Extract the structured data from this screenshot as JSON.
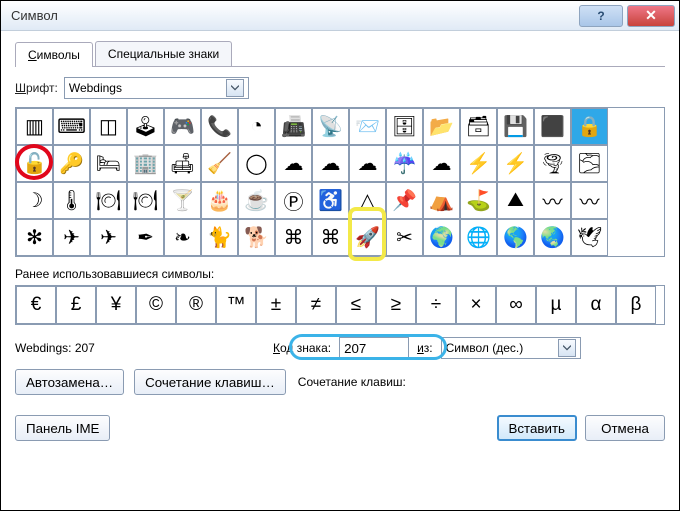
{
  "title": "Символ",
  "tabs": {
    "symbols": "Символы",
    "special": "Специальные знаки"
  },
  "font_label": "Шрифт:",
  "font_value": "Webdings",
  "grid": [
    [
      "▥",
      "⌨",
      "◫",
      "🕹",
      "🎮",
      "📞",
      "◔",
      "📠",
      "📡",
      "📨",
      "🗄",
      "📂",
      "🗃",
      "💾",
      "⬛",
      "🔒"
    ],
    [
      "🔓",
      "🔑",
      "🛏",
      "🏢",
      "🛋",
      "🧹",
      "◯",
      "☁",
      "☁",
      "☁",
      "☔",
      "☁",
      "⚡",
      "⚡",
      "🌪",
      "🌫"
    ],
    [
      "☽",
      "🌡",
      "🍽",
      "🍽",
      "🍸",
      "🎂",
      "☕",
      "Ⓟ",
      "♿",
      "△",
      "📌",
      "⛺",
      "⛳",
      "⛰",
      "〰",
      "〰"
    ],
    [
      "✻",
      "✈",
      "✈",
      "✒",
      "❧",
      "🐈",
      "🐕",
      "⌘",
      "⌘",
      "🚀",
      "✂",
      "🌍",
      "🌐",
      "🌎",
      "🌏",
      "🕊"
    ]
  ],
  "selected": {
    "row": 0,
    "col": 15
  },
  "recent_label": "Ранее использовавшиеся символы:",
  "recent": [
    "€",
    "£",
    "¥",
    "©",
    "®",
    "™",
    "±",
    "≠",
    "≤",
    "≥",
    "÷",
    "×",
    "∞",
    "µ",
    "α",
    "β"
  ],
  "info_name": "Webdings: 207",
  "code_label": "Код знака:",
  "code_value": "207",
  "from_label": "из:",
  "from_value": "Символ (дес.)",
  "autocorrect": "Автозамена…",
  "shortcut_btn": "Сочетание клавиш…",
  "shortcut_label": "Сочетание клавиш:",
  "ime_panel": "Панель IME",
  "insert": "Вставить",
  "cancel": "Отмена",
  "row_names": [
    [
      "barcode",
      "keyboard",
      "network",
      "joystick",
      "gamepad",
      "phone",
      "receiver",
      "fax",
      "satellite",
      "letter",
      "cabinet",
      "folder",
      "drawer",
      "floppy",
      "monitor",
      "lock-closed"
    ],
    [
      "lock-open",
      "key",
      "bed",
      "building",
      "sofa",
      "broom",
      "circle",
      "cloud",
      "clouds",
      "rain-cloud",
      "rain",
      "heavy-rain",
      "storm",
      "lightning",
      "tornado",
      "fog"
    ],
    [
      "moon",
      "thermometer",
      "plate",
      "cutlery",
      "cocktail",
      "cake",
      "coffee",
      "parking",
      "wheelchair",
      "triangle",
      "pushpin",
      "tent",
      "flag",
      "mountain",
      "wave1",
      "wave2"
    ],
    [
      "asterisk",
      "plane1",
      "plane2",
      "pen",
      "leaf",
      "cat",
      "dog",
      "knot1",
      "knot2",
      "rocket",
      "scissors",
      "globe-eu",
      "globe",
      "globe-am",
      "globe-as",
      "dove"
    ]
  ]
}
